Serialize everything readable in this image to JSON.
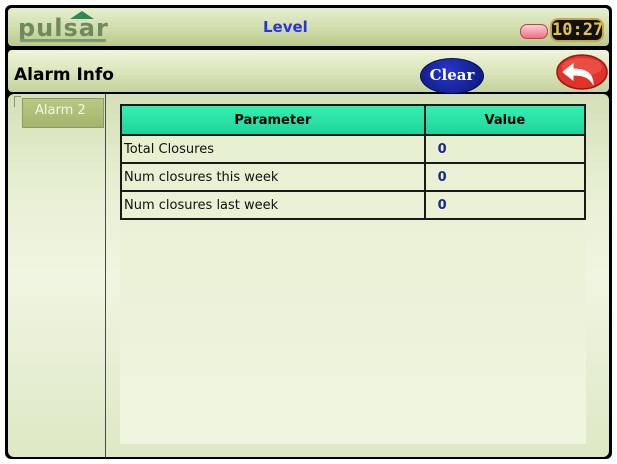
{
  "app": {
    "logo_text": "pulsar",
    "title": "Level",
    "clock": "10:27"
  },
  "header": {
    "title": "Alarm Info",
    "clear_label": "Clear"
  },
  "sidebar": {
    "tabs": [
      {
        "label": "Alarm 2"
      }
    ]
  },
  "table": {
    "columns": [
      "Parameter",
      "Value"
    ],
    "rows": [
      {
        "parameter": "Total Closures",
        "value": "0"
      },
      {
        "parameter": "Num closures this week",
        "value": "0"
      },
      {
        "parameter": "Num closures last week",
        "value": "0"
      }
    ]
  },
  "colors": {
    "title_blue": "#2a34d8",
    "table_header_green": "#35f0b2",
    "clear_button_blue": "#1a28a8",
    "back_button_red": "#e2332b"
  },
  "icons": {
    "back": "back-arrow-icon",
    "status_led": "status-led-icon"
  }
}
